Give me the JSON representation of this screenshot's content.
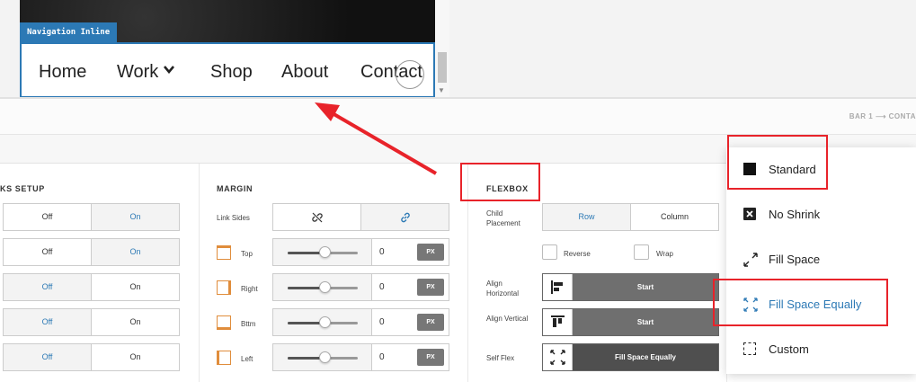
{
  "preview": {
    "nav_tag": "Navigation Inline",
    "nav_items": [
      "Home",
      "Work",
      "Shop",
      "About",
      "Contact"
    ],
    "nav_chevron": "❯"
  },
  "breadcrumb": "BAR 1 ⟶ CONTA",
  "links_setup": {
    "title": "KS SETUP",
    "rows": [
      {
        "left": "Off",
        "right": "On",
        "active": "right"
      },
      {
        "left": "Off",
        "right": "On",
        "active": "right"
      },
      {
        "left": "Off",
        "right": "On",
        "active": "left"
      },
      {
        "left": "Off",
        "right": "On",
        "active": "left"
      },
      {
        "left": "Off",
        "right": "On",
        "active": "left"
      }
    ]
  },
  "margin": {
    "title": "MARGIN",
    "link_sides_label": "Link Sides",
    "sides": [
      {
        "label": "Top",
        "value": "0",
        "unit": "PX"
      },
      {
        "label": "Right",
        "value": "0",
        "unit": "PX"
      },
      {
        "label": "Bttm",
        "value": "0",
        "unit": "PX"
      },
      {
        "label": "Left",
        "value": "0",
        "unit": "PX"
      }
    ]
  },
  "flexbox": {
    "title": "FLEXBOX",
    "child_placement_label": "Child Placement",
    "row_label": "Row",
    "column_label": "Column",
    "reverse_label": "Reverse",
    "wrap_label": "Wrap",
    "align_horizontal_label": "Align Horizontal",
    "align_horizontal_value": "Start",
    "align_vertical_label": "Align Vertical",
    "align_vertical_value": "Start",
    "self_flex_label": "Self Flex",
    "self_flex_value": "Fill Space Equally"
  },
  "dropdown": {
    "items": [
      "Standard",
      "No Shrink",
      "Fill Space",
      "Fill Space Equally",
      "Custom"
    ],
    "highlighted": "Fill Space Equally"
  },
  "colors": {
    "accent": "#2c79b5",
    "annotation": "#e8232a",
    "margin_icon": "#e08d3c"
  }
}
